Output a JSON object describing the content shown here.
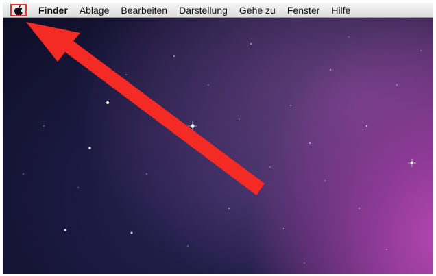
{
  "menubar": {
    "apple_menu_icon": "apple-icon",
    "items": [
      {
        "label": "Finder"
      },
      {
        "label": "Ablage"
      },
      {
        "label": "Bearbeiten"
      },
      {
        "label": "Darstellung"
      },
      {
        "label": "Gehe zu"
      },
      {
        "label": "Fenster"
      },
      {
        "label": "Hilfe"
      }
    ]
  },
  "annotation": {
    "highlight_color": "#e8302a",
    "arrow_color": "#f42a24"
  },
  "desktop": {
    "wallpaper": "space-nebula-purple"
  }
}
